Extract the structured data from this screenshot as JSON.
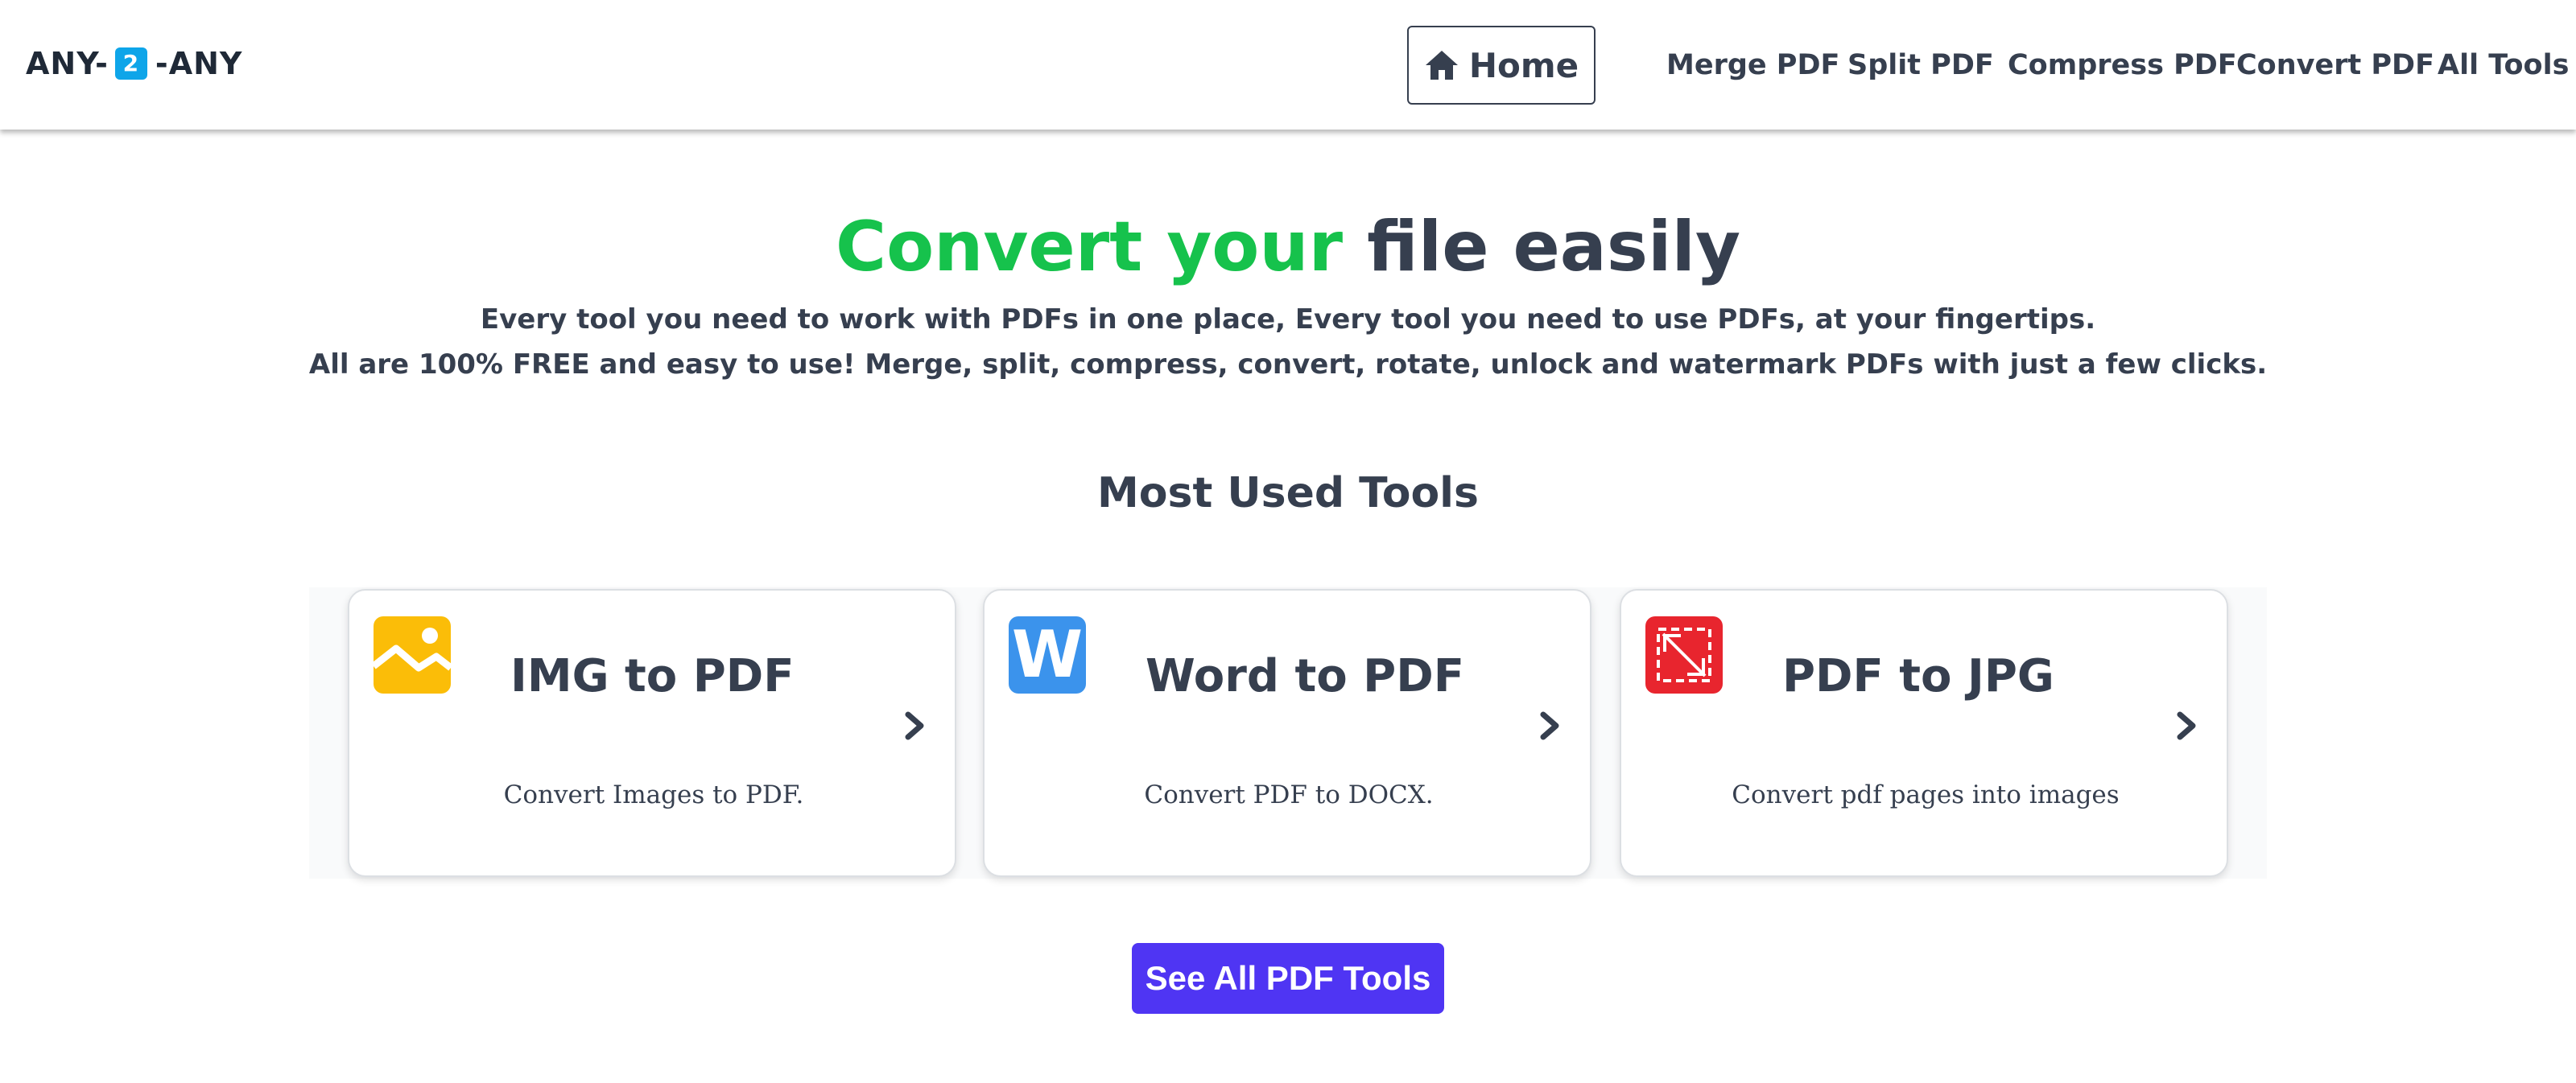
{
  "nav": {
    "logo_left": "ANY-",
    "logo_badge": "2",
    "logo_right": "-ANY",
    "home_label": "Home",
    "links": [
      "Merge PDF",
      "Split PDF",
      "Compress PDF",
      "Convert PDF",
      "All Tools"
    ]
  },
  "hero": {
    "title_highlight": "Convert your",
    "title_rest": "file easily",
    "subtitle_line1": "Every tool you need to work with PDFs in one place, Every tool you need to use PDFs, at your fingertips.",
    "subtitle_line2": "All are 100% FREE and easy to use! Merge, split, compress, convert, rotate, unlock and watermark PDFs with just a few clicks."
  },
  "section": {
    "title": "Most Used Tools"
  },
  "tools": [
    {
      "title": "IMG to PDF",
      "desc": "Convert Images to PDF.",
      "icon": "image-icon",
      "color": "#fbbd08"
    },
    {
      "title": "Word to PDF",
      "desc": "Convert PDF to DOCX.",
      "icon": "word-icon",
      "color": "#3b93ec",
      "icon_letter": "W"
    },
    {
      "title": "PDF to JPG",
      "desc": "Convert pdf pages into images",
      "icon": "pdf-convert-icon",
      "color": "#e8252e"
    }
  ],
  "cta": {
    "label": "See All PDF Tools",
    "color": "#4f35f3"
  },
  "colors": {
    "text": "#363f4f",
    "accent_green": "#16c24c",
    "logo_badge": "#0ea5e9"
  }
}
